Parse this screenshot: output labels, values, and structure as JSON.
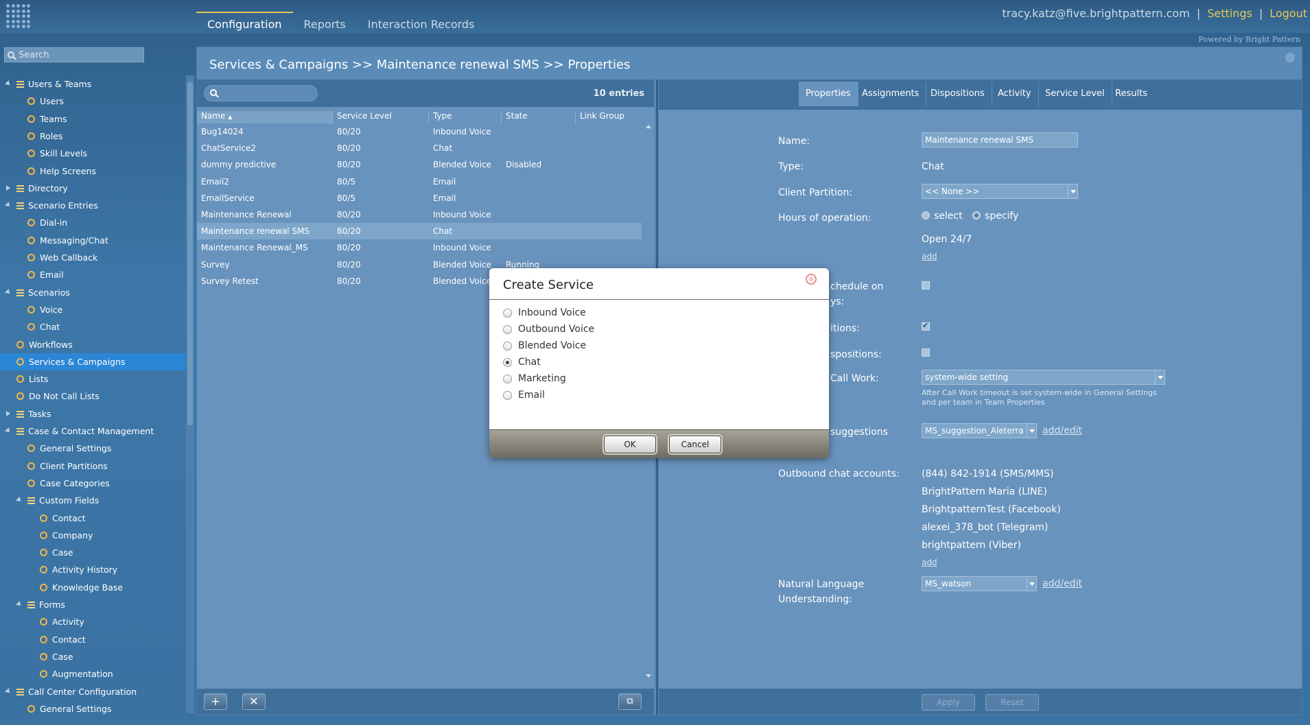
{
  "topbar": {
    "tabs": [
      "Configuration",
      "Reports",
      "Interaction Records"
    ],
    "user_email": "tracy.katz@five.brightpattern.com",
    "separator": "|",
    "settings_label": "Settings",
    "logout_label": "Logout",
    "powered_by": "Powered by Bright Pattern"
  },
  "sidebar": {
    "search_placeholder": "Search",
    "items": [
      {
        "label": "Users & Teams",
        "icon": "list-icon",
        "level": 0,
        "expanded": true
      },
      {
        "label": "Users",
        "icon": "gear-icon",
        "level": 1
      },
      {
        "label": "Teams",
        "icon": "gear-icon",
        "level": 1
      },
      {
        "label": "Roles",
        "icon": "gear-icon",
        "level": 1
      },
      {
        "label": "Skill Levels",
        "icon": "gear-icon",
        "level": 1
      },
      {
        "label": "Help Screens",
        "icon": "gear-icon",
        "level": 1
      },
      {
        "label": "Directory",
        "icon": "list-icon",
        "level": 0,
        "expanded": false
      },
      {
        "label": "Scenario Entries",
        "icon": "list-icon",
        "level": 0,
        "expanded": true
      },
      {
        "label": "Dial-in",
        "icon": "gear-icon",
        "level": 1
      },
      {
        "label": "Messaging/Chat",
        "icon": "gear-icon",
        "level": 1
      },
      {
        "label": "Web Callback",
        "icon": "gear-icon",
        "level": 1
      },
      {
        "label": "Email",
        "icon": "gear-icon",
        "level": 1
      },
      {
        "label": "Scenarios",
        "icon": "list-icon",
        "level": 0,
        "expanded": true
      },
      {
        "label": "Voice",
        "icon": "gear-icon",
        "level": 1
      },
      {
        "label": "Chat",
        "icon": "gear-icon",
        "level": 1
      },
      {
        "label": "Workflows",
        "icon": "gear-icon",
        "level": 0
      },
      {
        "label": "Services & Campaigns",
        "icon": "gear-icon",
        "level": 0,
        "selected": true
      },
      {
        "label": "Lists",
        "icon": "gear-icon",
        "level": 0
      },
      {
        "label": "Do Not Call Lists",
        "icon": "gear-icon",
        "level": 0
      },
      {
        "label": "Tasks",
        "icon": "list-icon",
        "level": 0,
        "expanded": false
      },
      {
        "label": "Case & Contact Management",
        "icon": "list-icon",
        "level": 0,
        "expanded": true
      },
      {
        "label": "General Settings",
        "icon": "gear-icon",
        "level": 1
      },
      {
        "label": "Client Partitions",
        "icon": "gear-icon",
        "level": 1
      },
      {
        "label": "Case Categories",
        "icon": "gear-icon",
        "level": 1
      },
      {
        "label": "Custom Fields",
        "icon": "list-icon",
        "level": 1,
        "expanded": true
      },
      {
        "label": "Contact",
        "icon": "gear-icon",
        "level": 2
      },
      {
        "label": "Company",
        "icon": "gear-icon",
        "level": 2
      },
      {
        "label": "Case",
        "icon": "gear-icon",
        "level": 2
      },
      {
        "label": "Activity History",
        "icon": "gear-icon",
        "level": 2
      },
      {
        "label": "Knowledge Base",
        "icon": "gear-icon",
        "level": 2
      },
      {
        "label": "Forms",
        "icon": "list-icon",
        "level": 1,
        "expanded": true
      },
      {
        "label": "Activity",
        "icon": "gear-icon",
        "level": 2
      },
      {
        "label": "Contact",
        "icon": "gear-icon",
        "level": 2
      },
      {
        "label": "Case",
        "icon": "gear-icon",
        "level": 2
      },
      {
        "label": "Augmentation",
        "icon": "gear-icon",
        "level": 2
      },
      {
        "label": "Call Center Configuration",
        "icon": "list-icon",
        "level": 0,
        "expanded": true
      },
      {
        "label": "General Settings",
        "icon": "gear-icon",
        "level": 1
      }
    ]
  },
  "main": {
    "breadcrumb": "Services & Campaigns >> Maintenance renewal SMS >> Properties",
    "list": {
      "entries": "10 entries",
      "columns": [
        "Name",
        "Service Level",
        "Type",
        "State",
        "Link Group"
      ],
      "rows": [
        [
          "Bug14024",
          "80/20",
          "Inbound Voice",
          "",
          ""
        ],
        [
          "ChatService2",
          "80/20",
          "Chat",
          "",
          ""
        ],
        [
          "dummy predictive",
          "80/20",
          "Blended Voice",
          "Disabled",
          ""
        ],
        [
          "Email2",
          "80/5",
          "Email",
          "",
          ""
        ],
        [
          "EmailService",
          "80/5",
          "Email",
          "",
          ""
        ],
        [
          "Maintenance Renewal",
          "80/20",
          "Inbound Voice",
          "",
          ""
        ],
        [
          "Maintenance renewal SMS",
          "80/20",
          "Chat",
          "",
          ""
        ],
        [
          "Maintenance Renewal_MS",
          "80/20",
          "Inbound Voice",
          "",
          ""
        ],
        [
          "Survey",
          "80/20",
          "Blended Voice",
          "Running",
          ""
        ],
        [
          "Survey Retest",
          "80/20",
          "Blended Voice",
          "",
          ""
        ]
      ],
      "selected_row": 6
    },
    "props": {
      "tabs": [
        "Properties",
        "Assignments",
        "Dispositions",
        "Activity",
        "Service Level",
        "Results"
      ],
      "name_label": "Name:",
      "name_value": "Maintenance renewal SMS",
      "type_label": "Type:",
      "type_value": "Chat",
      "partition_label": "Client Partition:",
      "partition_value": "<< None >>",
      "hours_label": "Hours of operation:",
      "hours_select": "select",
      "hours_specify": "specify",
      "hours_value": "Open 24/7",
      "add_link": "add",
      "schedule_label_a": "chedule on",
      "schedule_label_b": "ys:",
      "dispositions_label": "itions:",
      "dispositions2_label": "spositions:",
      "acw_label": "Call Work:",
      "acw_value": "system-wide setting",
      "acw_note": "After Call Work timeout is set system-wide in General Settings and per team in Team Properties",
      "suggestions_label": "suggestions",
      "suggestions_value": "MS_suggestion_Aleterra",
      "add_edit": "add/edit",
      "outbound_label": "Outbound chat accounts:",
      "outbound_accounts": [
        "(844) 842-1914 (SMS/MMS)",
        "BrightPattern Maria (LINE)",
        "BrightpatternTest (Facebook)",
        "alexei_378_bot (Telegram)",
        "brightpattern (Viber)"
      ],
      "nlu_label_a": "Natural Language",
      "nlu_label_b": "Understanding:",
      "nlu_value": "MS_watson",
      "apply_label": "Apply",
      "reset_label": "Reset"
    }
  },
  "dialog": {
    "title": "Create Service",
    "options": [
      "Inbound Voice",
      "Outbound Voice",
      "Blended Voice",
      "Chat",
      "Marketing",
      "Email"
    ],
    "selected": 3,
    "ok_label": "OK",
    "cancel_label": "Cancel"
  }
}
